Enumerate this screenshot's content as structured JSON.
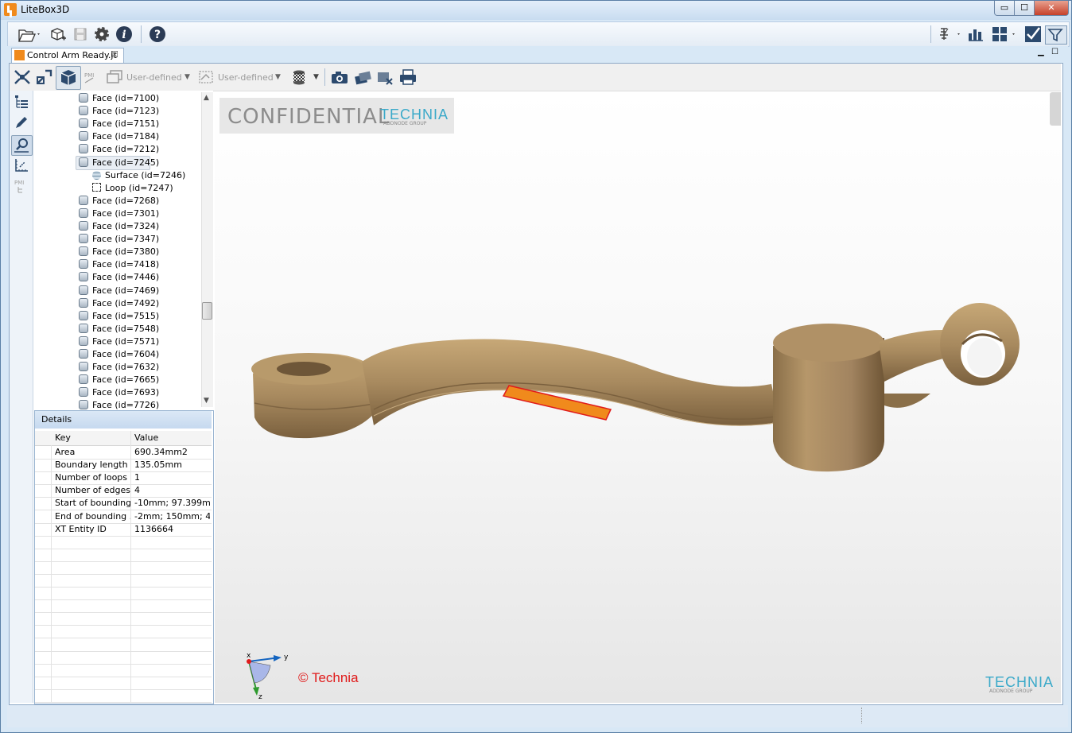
{
  "window": {
    "title": "LiteBox3D",
    "minimize": "▭",
    "maximize": "☐",
    "close": "✕"
  },
  "document_tab": {
    "label": "Control Arm Ready.jt",
    "close": "☒"
  },
  "view_toolbar": {
    "view_dropdown_1": "User-defined",
    "view_dropdown_2": "User-defined",
    "pmi_label": "PMI"
  },
  "side_toolbar": {
    "pmi_label": "PMI"
  },
  "tree": {
    "rows": [
      "Face (id=7100)",
      "Face (id=7123)",
      "Face (id=7151)",
      "Face (id=7184)",
      "Face (id=7212)",
      "Face (id=7245)",
      "Surface (id=7246)",
      "Loop (id=7247)",
      "Face (id=7268)",
      "Face (id=7301)",
      "Face (id=7324)",
      "Face (id=7347)",
      "Face (id=7380)",
      "Face (id=7418)",
      "Face (id=7446)",
      "Face (id=7469)",
      "Face (id=7492)",
      "Face (id=7515)",
      "Face (id=7548)",
      "Face (id=7571)",
      "Face (id=7604)",
      "Face (id=7632)",
      "Face (id=7665)",
      "Face (id=7693)",
      "Face (id=7726)"
    ],
    "scroll_up": "▲",
    "scroll_down": "▼"
  },
  "details": {
    "title": "Details",
    "col_key": "Key",
    "col_value": "Value",
    "rows": [
      {
        "key": "Area",
        "value": "690.34mm2"
      },
      {
        "key": "Boundary length",
        "value": "135.05mm"
      },
      {
        "key": "Number of loops",
        "value": "1"
      },
      {
        "key": "Number of edges",
        "value": "4"
      },
      {
        "key": "Start of bounding...",
        "value": "-10mm; 97.399m..."
      },
      {
        "key": "End of bounding ...",
        "value": "-2mm; 150mm; 4..."
      },
      {
        "key": "XT Entity ID",
        "value": "1136664"
      }
    ]
  },
  "viewport": {
    "confidential": "CONFIDENTIAL",
    "brand": "TECHNIA",
    "brand_sub": "ADDNODE GROUP",
    "copyright": "© Technia",
    "axis_x": "x",
    "axis_y": "y",
    "axis_z": "z",
    "model_color": "#a88a5f",
    "highlight_color": "#f08a1c"
  }
}
